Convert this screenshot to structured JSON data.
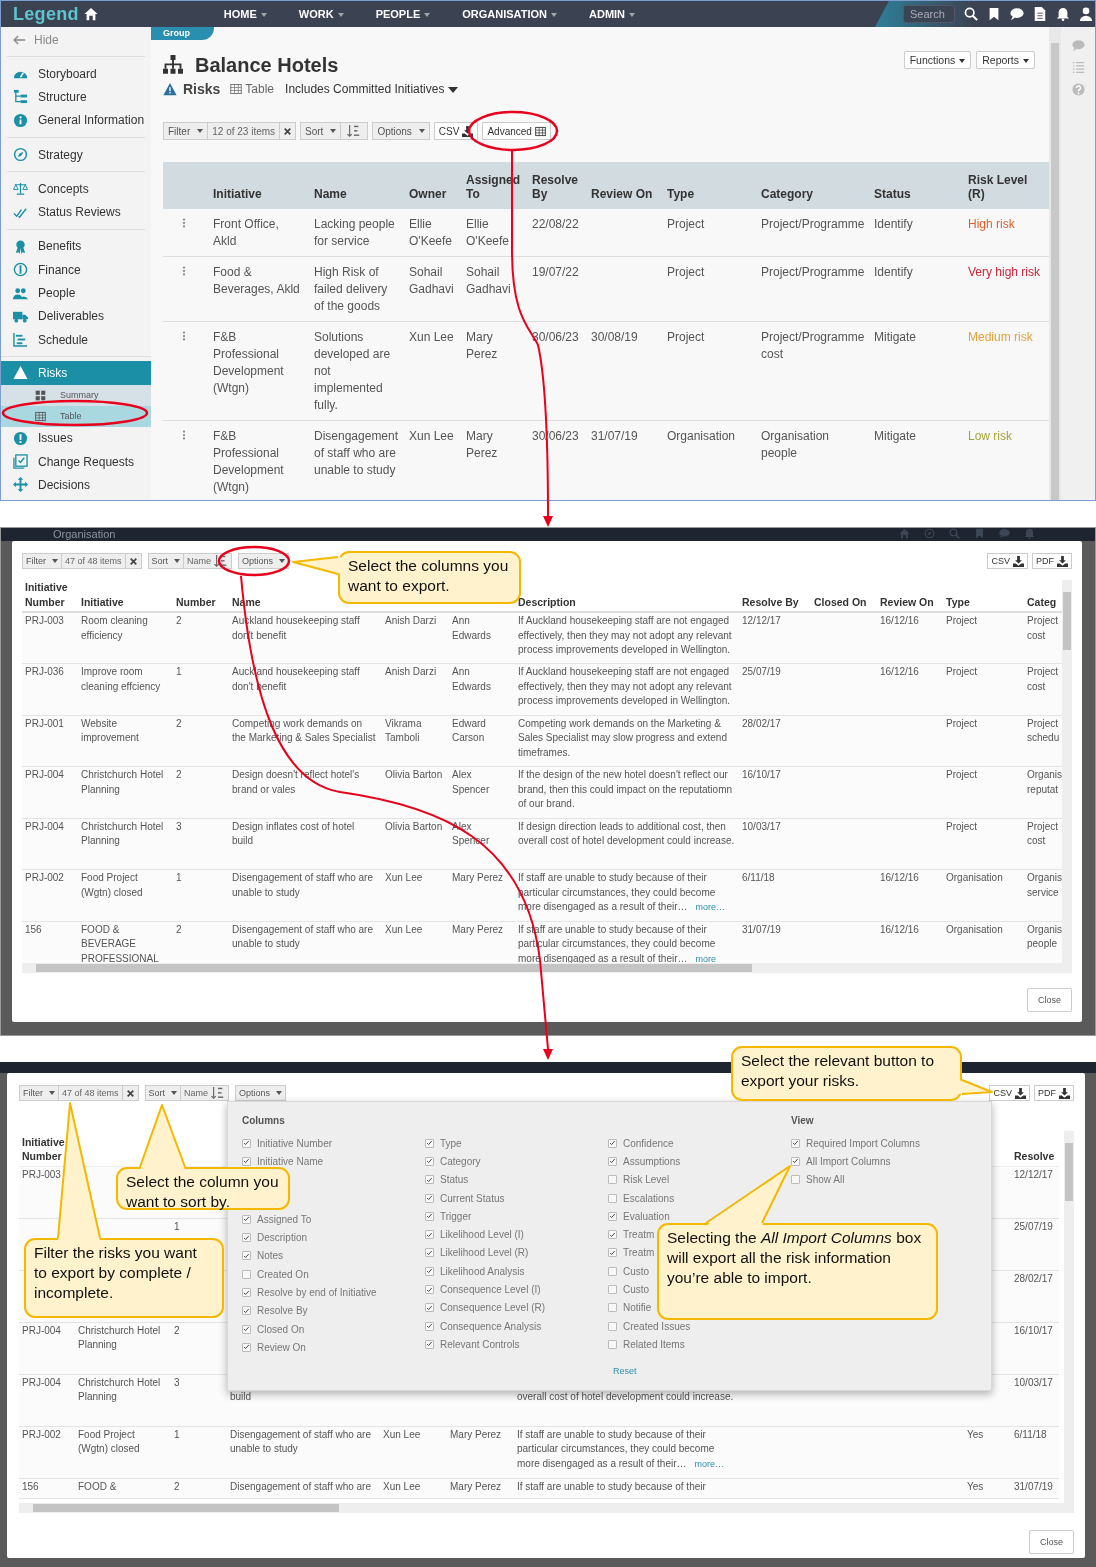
{
  "main_screen": {
    "nav": {
      "logo": "Legend",
      "menu": [
        "HOME",
        "WORK",
        "PEOPLE",
        "ORGANISATION",
        "ADMIN"
      ],
      "search": {
        "placeholder": "Search"
      }
    },
    "sidebar": {
      "hide": "Hide",
      "groups": [
        [
          {
            "label": "Storyboard",
            "selected": false
          },
          {
            "label": "Structure",
            "selected": false
          },
          {
            "label": "General Information",
            "selected": false
          }
        ],
        [
          {
            "label": "Strategy",
            "selected": false
          }
        ],
        [
          {
            "label": "Concepts",
            "selected": false
          },
          {
            "label": "Status Reviews",
            "selected": false
          }
        ],
        [
          {
            "label": "Benefits",
            "selected": false
          },
          {
            "label": "Finance",
            "selected": false
          },
          {
            "label": "People",
            "selected": false
          },
          {
            "label": "Deliverables",
            "selected": false
          },
          {
            "label": "Schedule",
            "selected": false
          }
        ],
        [
          {
            "label": "Risks",
            "selected": true,
            "children": [
              {
                "label": "Summary",
                "selected": false
              },
              {
                "label": "Table",
                "selected": true
              }
            ]
          },
          {
            "label": "Issues",
            "selected": false
          },
          {
            "label": "Change Requests",
            "selected": false
          },
          {
            "label": "Decisions",
            "selected": false
          }
        ]
      ]
    },
    "breadcrumb": "Group",
    "title": "Balance Hotels",
    "subtitle": {
      "module": "Risks",
      "view": "Table",
      "scope": "Includes Committed Initiatives"
    },
    "actions": [
      "Functions",
      "Reports"
    ],
    "toolbar": {
      "filter": "Filter",
      "count": "12 of 23 items",
      "sort": "Sort",
      "options": "Options",
      "csv": "CSV",
      "advanced": "Advanced"
    },
    "table": {
      "columns": [
        "Initiative",
        "Name",
        "Owner",
        "Assigned To",
        "Resolve By",
        "Review On",
        "Type",
        "Category",
        "Status",
        "Risk Level (R)"
      ],
      "rows": [
        {
          "cells": [
            "Front Office, Akld",
            "Lacking people for service",
            "Ellie O'Keefe",
            "Ellie O'Keefe",
            "22/08/22",
            null,
            "Project",
            "Project/Programme",
            "Identify",
            "High risk"
          ],
          "color": "#e0602f"
        },
        {
          "cells": [
            "Food & Beverages, Akld",
            "High Risk of failed delivery of the goods",
            "Sohail Gadhavi",
            "Sohail Gadhavi",
            "19/07/22",
            null,
            "Project",
            "Project/Programme",
            "Identify",
            "Very high risk"
          ],
          "color": "#c9243a"
        },
        {
          "cells": [
            "F&B Professional Development (Wtgn)",
            "Solutions developed are not implemented fully.",
            "Xun Lee",
            "Mary Perez",
            "30/06/23",
            "30/08/19",
            "Project",
            "Project/Programme cost",
            "Mitigate",
            "Medium risk"
          ],
          "color": "#e3a03a"
        },
        {
          "cells": [
            "F&B Professional Development (Wtgn)",
            "Disengagement of staff who are unable to study",
            "Xun Lee",
            "Mary Perez",
            "30/06/23",
            "31/07/19",
            "Organisation",
            "Organisation people",
            "Mitigate",
            "Low risk"
          ],
          "color": "#a3a43a"
        }
      ]
    }
  },
  "export_dialog": {
    "top_bar": "Organisation",
    "toolbar": {
      "filter": "Filter",
      "count": "47 of 48 items",
      "sort": "Sort",
      "sort_field": "Name",
      "options": "Options"
    },
    "export_buttons": [
      "CSV",
      "PDF"
    ],
    "table": {
      "columns": [
        "Initiative Number",
        "Initiative",
        "Number",
        "Name",
        null,
        null,
        "Description",
        "Resolve By",
        "Closed On",
        "Review On",
        "Type",
        "Categ"
      ],
      "rows": [
        {
          "cells": [
            "PRJ-003",
            "Room cleaning efficiency",
            "2",
            "Auckland housekeeping staff don't benefit",
            "Anish Darzi",
            "Ann Edwards",
            "If Auckland housekeeping staff are not engaged effectively, then they may not adopt any relevant process improvements developed in Wellington.",
            "12/12/17",
            null,
            "16/12/16",
            "Project",
            [
              "Project",
              "cost"
            ]
          ]
        },
        {
          "cells": [
            "PRJ-036",
            "Improve room cleaning effciency",
            "1",
            "Auckland housekeeping staff don't benefit",
            "Anish Darzi",
            "Ann Edwards",
            "If Auckland housekeeping staff are not engaged effectively, then they may not adopt any relevant process improvements developed in Wellington.",
            "25/07/19",
            null,
            "16/12/16",
            "Project",
            [
              "Project",
              "cost"
            ]
          ]
        },
        {
          "cells": [
            "PRJ-001",
            "Website improvement",
            "2",
            "Competing work demands on the Marketing & Sales Specialist",
            "Vikrama Tamboli",
            "Edward Carson",
            "Competing work demands on the Marketing & Sales Specialist may slow progress and extend timeframes.",
            "28/02/17",
            null,
            null,
            "Project",
            [
              "Project",
              "schedu"
            ]
          ]
        },
        {
          "cells": [
            "PRJ-004",
            "Christchurch Hotel Planning",
            "2",
            "Design doesn't reflect hotel's brand or vales",
            "Olivia Barton",
            "Alex Spencer",
            "If the design of the new hotel doesn't reflect our brand, then this could impact on the reputatiomn of our brand.",
            "16/10/17",
            null,
            null,
            "Project",
            [
              "Organis",
              "reputat"
            ]
          ]
        },
        {
          "cells": [
            "PRJ-004",
            "Christchurch Hotel Planning",
            "3",
            "Design inflates cost of hotel build",
            "Olivia Barton",
            "Alex Spencer",
            "If design direction leads to additional cost, then overall cost of hotel development could increase.",
            "10/03/17",
            null,
            null,
            "Project",
            [
              "Project",
              "cost"
            ]
          ]
        },
        {
          "cells": [
            "PRJ-002",
            "Food Project (Wgtn) closed",
            "1",
            "Disengagement of staff who are unable to study",
            "Xun Lee",
            "Mary Perez",
            "If staff are unable to study because of their particular circumstances, they could become more disengaged as a result of their…",
            "6/11/18",
            null,
            "16/12/16",
            "Organisation",
            [
              "Organis",
              "service"
            ]
          ],
          "more": "more…"
        },
        {
          "cells": [
            "156",
            "FOOD & BEVERAGE PROFESSIONAL",
            "2",
            "Disengagement of staff who are unable to study",
            "Xun Lee",
            "Mary Perez",
            "If staff are unable to study because of their particular circumstances, they could become more disengaged as a result of their…",
            "31/07/19",
            null,
            "16/12/16",
            "Organisation",
            [
              "Organis",
              "people"
            ]
          ],
          "more": "more"
        }
      ]
    },
    "close": "Close"
  },
  "export_options": {
    "toolbar": {
      "filter": "Filter",
      "count": "47 of 48 items",
      "sort": "Sort",
      "sort_field": "Name",
      "options": "Options"
    },
    "export_buttons": [
      "CSV",
      "PDF"
    ],
    "table": {
      "columns": [
        "Initiative Number",
        null,
        null,
        null,
        null,
        null,
        null,
        null,
        null,
        "Resolve"
      ],
      "rows": [
        {
          "cells": [
            "PRJ-003",
            null,
            null,
            null,
            null,
            null,
            null,
            null,
            null,
            "12/12/17"
          ]
        },
        {
          "cells": [
            null,
            null,
            "1",
            null,
            null,
            null,
            null,
            null,
            null,
            "25/07/19"
          ]
        },
        {
          "cells": [
            null,
            null,
            null,
            null,
            null,
            null,
            null,
            null,
            null,
            "28/02/17"
          ]
        },
        {
          "cells": [
            "PRJ-004",
            "Christchurch Hotel Planning",
            "2",
            null,
            null,
            null,
            null,
            null,
            null,
            "16/10/17"
          ]
        },
        {
          "cells": [
            "PRJ-004",
            "Christchurch Hotel Planning",
            "3",
            {
              "text": "build",
              "kind": "continued"
            },
            null,
            null,
            {
              "text": "overall cost of hotel development could increase.",
              "kind": "continued"
            },
            null,
            null,
            "10/03/17"
          ]
        },
        {
          "cells": [
            "PRJ-002",
            "Food Project (Wgtn) closed",
            "1",
            "Disengagement of staff who are unable to study",
            "Xun Lee",
            "Mary Perez",
            "If staff are unable to study because of their particular circumstances, they could become more disengaged as a result of their…",
            null,
            "Yes",
            "6/11/18"
          ],
          "more": "more…"
        },
        {
          "cells": [
            "156",
            "FOOD &",
            "2",
            "Disengagement of staff who are",
            "Xun Lee",
            "Mary Perez",
            "If staff are unable to study because of their",
            null,
            "Yes",
            "31/07/19"
          ]
        }
      ]
    },
    "options_menu": {
      "columns_title": "Columns",
      "columns": [
        {
          "groups": [
            [
              {
                "label": "Initiative Number",
                "checked": true
              },
              {
                "label": "Initiative Name",
                "checked": true
              }
            ],
            [
              {
                "label": "Assigned To",
                "checked": true
              },
              {
                "label": "Description",
                "checked": true
              },
              {
                "label": "Notes",
                "checked": true
              },
              {
                "label": "Created On",
                "checked": false
              },
              {
                "label": "Resolve by end of Initiative",
                "checked": true
              },
              {
                "label": "Resolve By",
                "checked": true
              },
              {
                "label": "Closed On",
                "checked": true
              },
              {
                "label": "Review On",
                "checked": true
              }
            ]
          ]
        },
        {
          "groups": [
            [
              {
                "label": "Type",
                "checked": true
              },
              {
                "label": "Category",
                "checked": true
              },
              {
                "label": "Status",
                "checked": true
              },
              {
                "label": "Current Status",
                "checked": true
              },
              {
                "label": "Trigger",
                "checked": true
              },
              {
                "label": "Likelihood Level (I)",
                "checked": true
              },
              {
                "label": "Likelihood Level (R)",
                "checked": true
              },
              {
                "label": "Likelihood Analysis",
                "checked": true
              },
              {
                "label": "Consequence Level (I)",
                "checked": true
              },
              {
                "label": "Consequence Level (R)",
                "checked": true
              },
              {
                "label": "Consequence Analysis",
                "checked": true
              },
              {
                "label": "Relevant Controls",
                "checked": true
              }
            ]
          ]
        },
        {
          "groups": [
            [
              {
                "label": "Confidence",
                "checked": true
              },
              {
                "label": "Assumptions",
                "checked": true
              },
              {
                "label": "Risk Level",
                "checked": false
              },
              {
                "label": "Escalations",
                "checked": false
              },
              {
                "label": "Evaluation",
                "checked": true
              },
              {
                "label": "Treatm",
                "checked": true
              },
              {
                "label": "Treatm",
                "checked": true
              },
              {
                "label": "Custo",
                "checked": false
              },
              {
                "label": "Custo",
                "checked": false
              },
              {
                "label": "Notifie",
                "checked": false
              },
              {
                "label": "Created Issues",
                "checked": false
              },
              {
                "label": "Related Items",
                "checked": false
              }
            ]
          ]
        }
      ],
      "view_title": "View",
      "view": [
        {
          "label": "Required Import Columns",
          "checked": true
        },
        {
          "label": "All Import Columns",
          "checked": true
        },
        {
          "label": "Show All",
          "checked": false
        }
      ],
      "reset": "Reset"
    },
    "close": "Close"
  },
  "annotations": [
    {
      "text": "Select the columns you want to export."
    },
    {
      "text": "Select the relevant button to export your risks."
    },
    {
      "text": "Select the column you want to sort by."
    },
    {
      "text": "Filter the risks you want to export by complete / incomplete."
    },
    {
      "text": "Selecting the *All Import Columns* box will export all the risk information you’re able to import."
    }
  ]
}
